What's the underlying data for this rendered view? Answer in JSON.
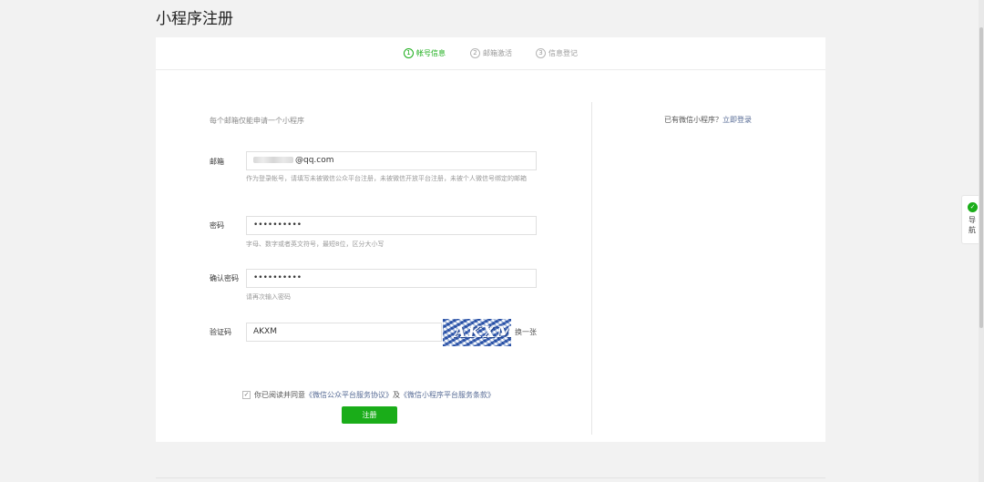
{
  "page": {
    "title": "小程序注册"
  },
  "steps": [
    {
      "num": "1",
      "label": "帐号信息"
    },
    {
      "num": "2",
      "label": "邮箱激活"
    },
    {
      "num": "3",
      "label": "信息登记"
    }
  ],
  "form": {
    "hint": "每个邮箱仅能申请一个小程序",
    "email": {
      "label": "邮箱",
      "value_suffix": "@qq.com",
      "tip": "作为登录帐号，请填写未被微信公众平台注册，未被微信开放平台注册，未被个人微信号绑定的邮箱"
    },
    "password": {
      "label": "密码",
      "value": "••••••••••",
      "tip": "字母、数字或者英文符号，最短8位，区分大小写"
    },
    "confirm_password": {
      "label": "确认密码",
      "value": "••••••••••",
      "tip": "请再次输入密码"
    },
    "captcha": {
      "label": "验证码",
      "value": "AKXM",
      "image_text": "AKXM",
      "refresh_label": "换一张"
    },
    "agree": {
      "prefix": "你已阅读并同意",
      "link1": "《微信公众平台服务协议》",
      "middle": "及",
      "link2": "《微信小程序平台服务条款》"
    },
    "submit_label": "注册"
  },
  "side": {
    "text": "已有微信小程序？",
    "link": "立即登录"
  },
  "nav_float": {
    "label": "导航"
  },
  "colors": {
    "accent": "#1aad19",
    "link": "#576b95"
  }
}
